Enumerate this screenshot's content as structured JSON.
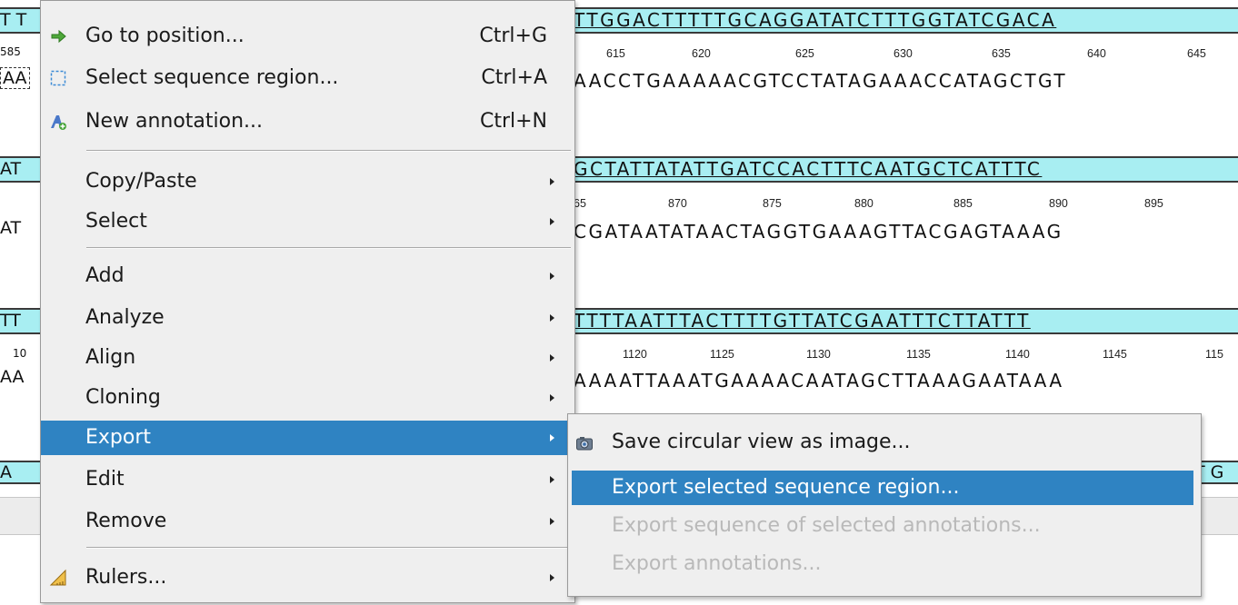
{
  "sequence_rows": [
    {
      "top": "TTGGACTTTTTGCAGGATATCTTTGGTATCGACA",
      "bottom": "AACCTGAAAAACGTCCTATAGAAACCATAGCTGT",
      "ruler": [
        "615",
        "620",
        "625",
        "630",
        "635",
        "640",
        "645"
      ],
      "left_top": "T T",
      "left_ruler": "585",
      "left_bottom": "AA"
    },
    {
      "top": "GCTATTATATTGATCCACTTTCAATGCTCATTTC",
      "bottom": "CGATAATATAACTAGGTGAAAGTTACGAGTAAAG",
      "ruler": [
        "65",
        "870",
        "875",
        "880",
        "885",
        "890",
        "895"
      ],
      "left_top": "AT",
      "left_ruler": "",
      "left_bottom": "AT"
    },
    {
      "top": "TTTTAATTTACTTTTGTTATCGAATTTCTTATTT",
      "bottom": "AAAATTAAATGAAAACAATAGCTTAAAGAATAAA",
      "ruler": [
        "1120",
        "1125",
        "1130",
        "1135",
        "1140",
        "1145",
        "115"
      ],
      "left_top": "TT",
      "left_ruler": "10",
      "left_bottom": "AA"
    },
    {
      "top": "",
      "bottom": "",
      "ruler": [],
      "left_top": "A",
      "left_ruler": "",
      "left_bottom": "",
      "right_top": "T G"
    }
  ],
  "context_menu": {
    "items": [
      {
        "label": "Go to position...",
        "shortcut": "Ctrl+G",
        "icon": "go-to-arrow-icon"
      },
      {
        "label": "Select sequence region...",
        "shortcut": "Ctrl+A",
        "icon": "select-region-icon"
      },
      {
        "label": "New annotation...",
        "shortcut": "Ctrl+N",
        "icon": "new-annotation-icon"
      },
      {
        "label": "Copy/Paste",
        "submenu": true
      },
      {
        "label": "Select",
        "submenu": true
      },
      {
        "label": "Add",
        "submenu": true
      },
      {
        "label": "Analyze",
        "submenu": true
      },
      {
        "label": "Align",
        "submenu": true
      },
      {
        "label": "Cloning",
        "submenu": true
      },
      {
        "label": "Export",
        "submenu": true,
        "active": true
      },
      {
        "label": "Edit",
        "submenu": true
      },
      {
        "label": "Remove",
        "submenu": true
      },
      {
        "label": "Rulers...",
        "submenu": true,
        "icon": "ruler-icon"
      }
    ]
  },
  "export_submenu": {
    "items": [
      {
        "label": "Save circular view as image...",
        "icon": "camera-icon"
      },
      {
        "label": "Export selected sequence region...",
        "active": true
      },
      {
        "label": "Export sequence of selected annotations...",
        "disabled": true
      },
      {
        "label": "Export annotations...",
        "disabled": true
      }
    ]
  },
  "colors": {
    "highlight": "#2f83c2",
    "strand_bg": "#a8eef2",
    "menu_bg": "#efefef"
  }
}
